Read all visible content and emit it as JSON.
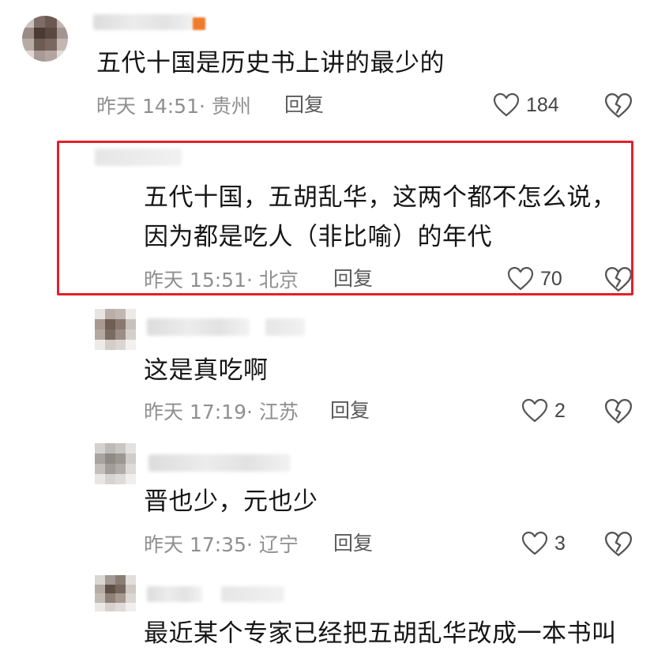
{
  "comments": [
    {
      "text": "五代十国是历史书上讲的最少的",
      "time": "昨天 14:51",
      "location": "· 贵州",
      "reply_label": "回复",
      "likes": "184"
    },
    {
      "text_line1": "五代十国，五胡乱华，这两个都不怎么说，",
      "text_line2": "因为都是吃人（非比喻）的年代",
      "time": "昨天 15:51",
      "location": "· 北京",
      "reply_label": "回复",
      "likes": "70"
    },
    {
      "text": "这是真吃啊",
      "time": "昨天 17:19",
      "location": "· 江苏",
      "reply_label": "回复",
      "likes": "2"
    },
    {
      "text": "晋也少，元也少",
      "time": "昨天 17:35",
      "location": "· 辽宁",
      "reply_label": "回复",
      "likes": "3"
    },
    {
      "text": "最近某个专家已经把五胡乱华改成一本书叫"
    }
  ],
  "colors": {
    "highlight": "#e2202c",
    "meta_text": "#8f8f8f",
    "icon_stroke": "#555555"
  },
  "icons": {
    "like": "heart-outline-icon",
    "dislike": "broken-heart-icon"
  }
}
